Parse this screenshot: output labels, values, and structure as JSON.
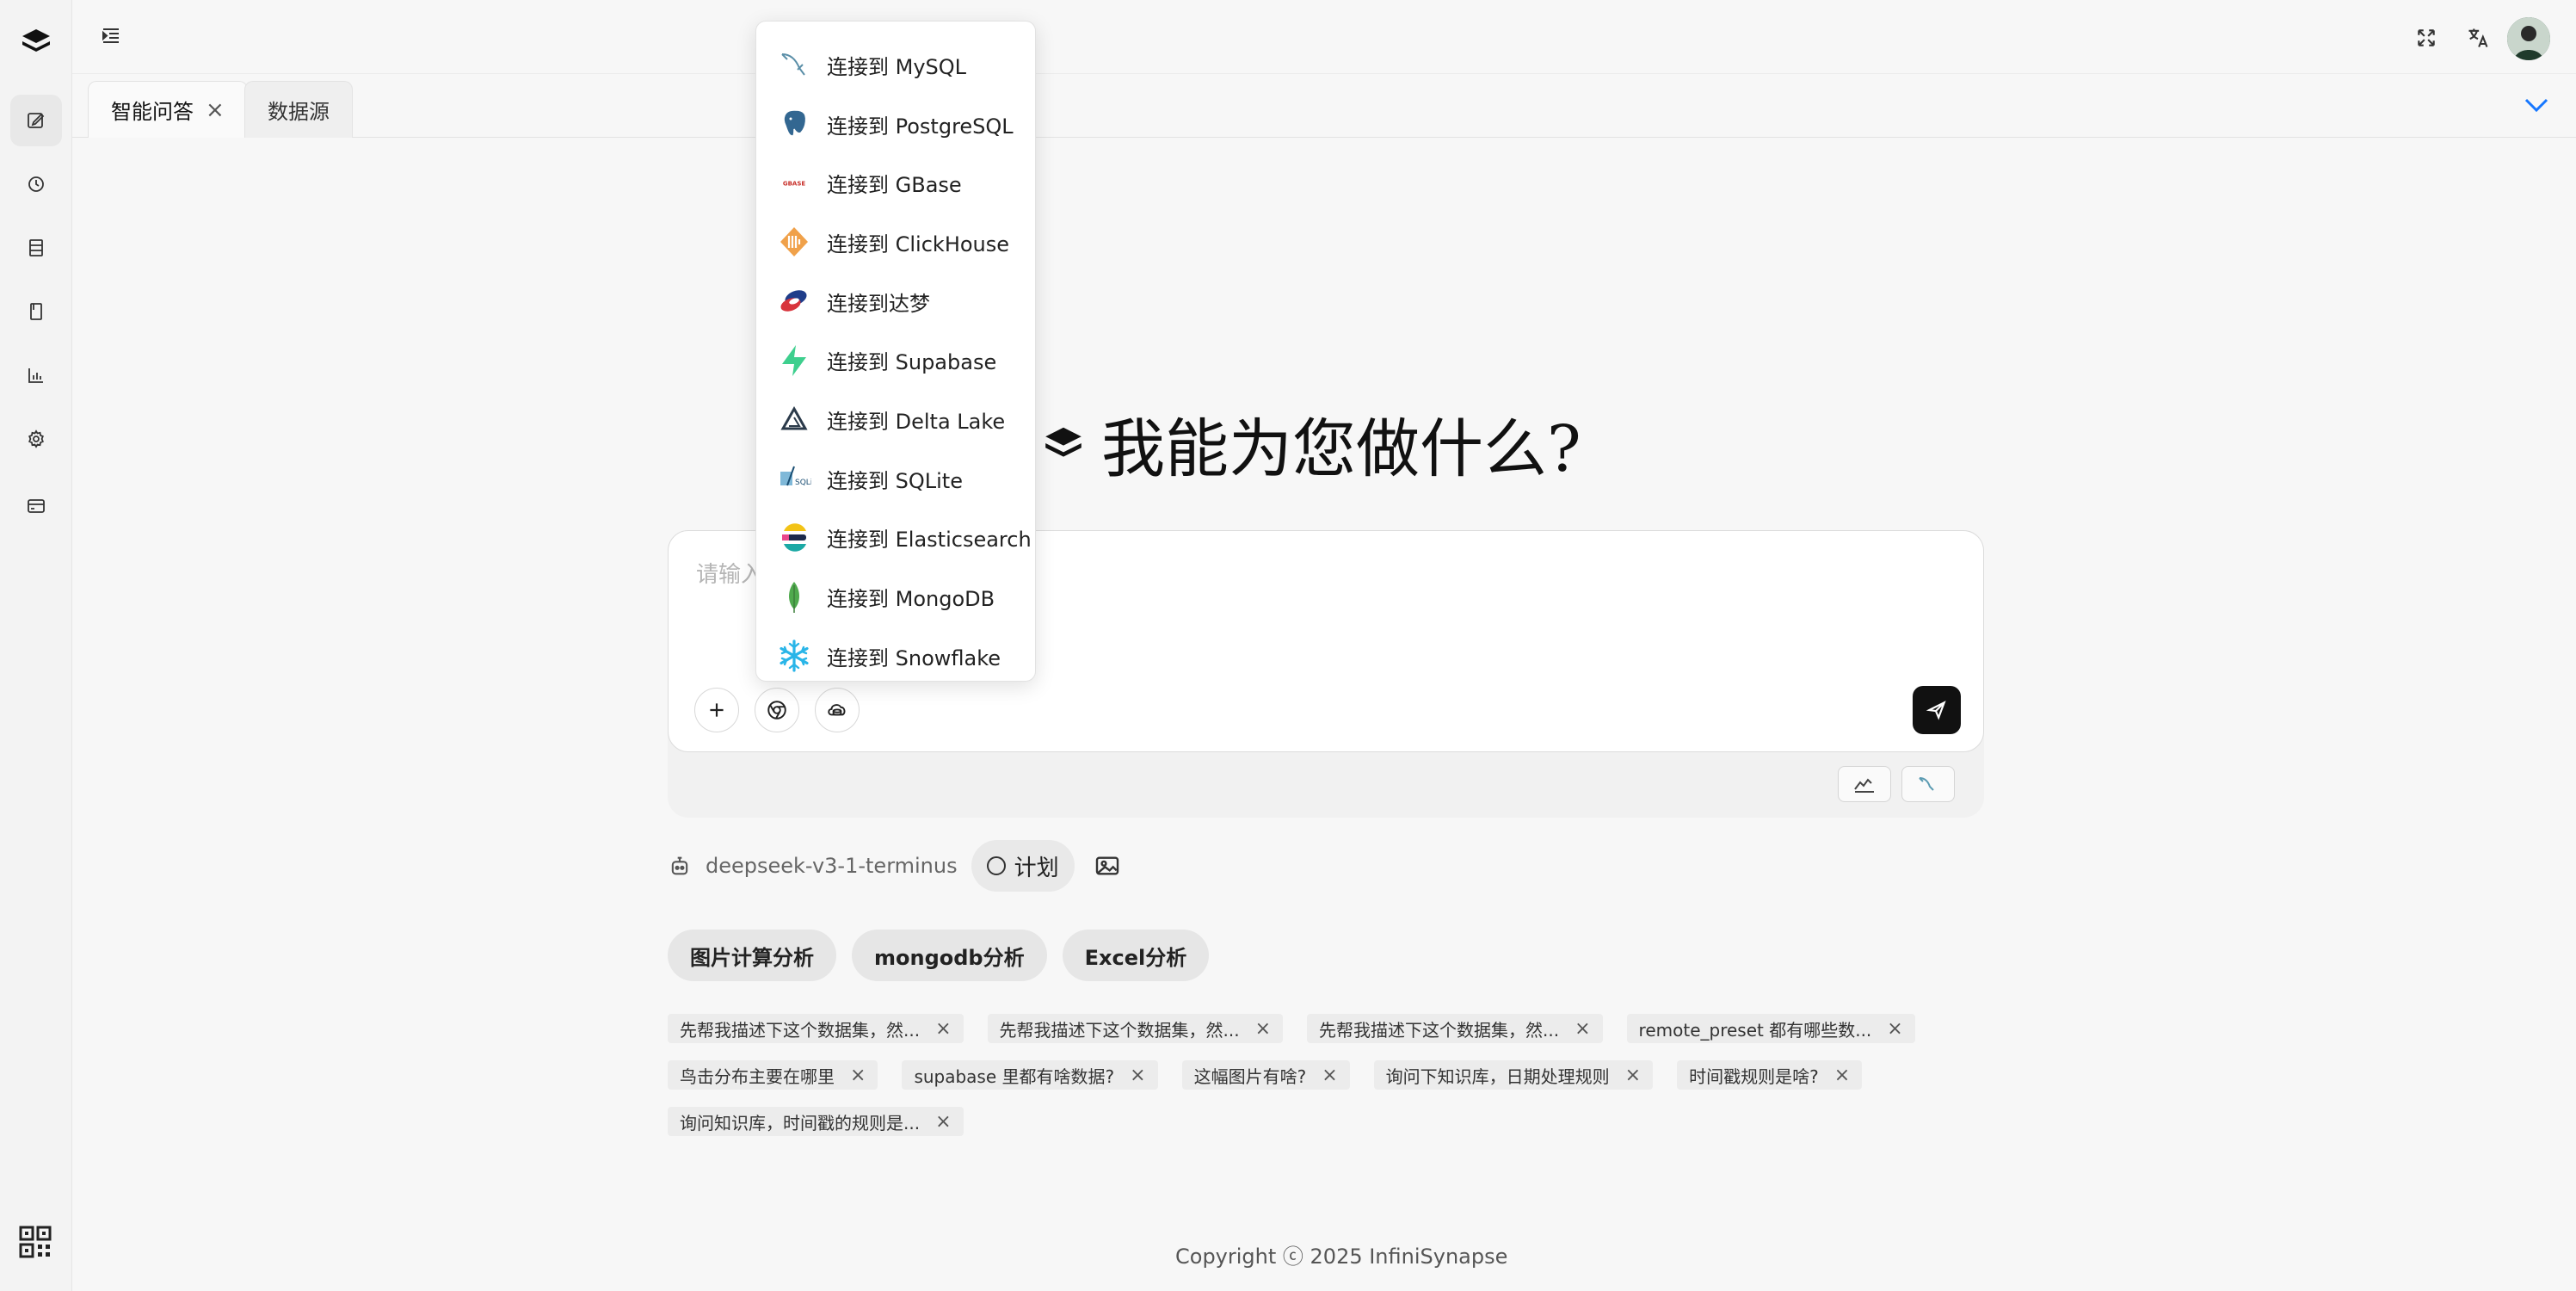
{
  "sidebar": {
    "items": [
      {
        "name": "new-chat",
        "icon": "edit-icon",
        "active": true
      },
      {
        "name": "history",
        "icon": "history-icon",
        "active": false
      },
      {
        "name": "database",
        "icon": "database-icon",
        "active": false
      },
      {
        "name": "knowledge",
        "icon": "book-icon",
        "active": false
      },
      {
        "name": "charts",
        "icon": "bar-chart-icon",
        "active": false
      },
      {
        "name": "settings",
        "icon": "gear-icon",
        "active": false
      },
      {
        "name": "billing",
        "icon": "card-icon",
        "active": false
      }
    ]
  },
  "tabs": [
    {
      "label": "智能问答",
      "active": true,
      "closable": true
    },
    {
      "label": "数据源",
      "active": false,
      "closable": false
    }
  ],
  "hero": {
    "title": "我能为您做什么?"
  },
  "input": {
    "placeholder": "请输入"
  },
  "model": {
    "name": "deepseek-v3-1-terminus"
  },
  "plan": {
    "label": "计划"
  },
  "quick_actions": [
    "图片计算分析",
    "mongodb分析",
    "Excel分析"
  ],
  "history": [
    [
      "先帮我描述下这个数据集，然...",
      "先帮我描述下这个数据集，然...",
      "先帮我描述下这个数据集，然...",
      "remote_preset 都有哪些数..."
    ],
    [
      "鸟击分布主要在哪里",
      "supabase 里都有啥数据?",
      "这幅图片有啥?",
      "询问下知识库，日期处理规则",
      "时间戳规则是啥?"
    ],
    [
      "询问知识库，时间戳的规则是..."
    ]
  ],
  "dropdown": {
    "items": [
      {
        "label": "连接到 MySQL",
        "icon": "mysql-icon"
      },
      {
        "label": "连接到 PostgreSQL",
        "icon": "postgresql-icon"
      },
      {
        "label": "连接到 GBase",
        "icon": "gbase-icon"
      },
      {
        "label": "连接到 ClickHouse",
        "icon": "clickhouse-icon"
      },
      {
        "label": "连接到达梦",
        "icon": "dameng-icon"
      },
      {
        "label": "连接到 Supabase",
        "icon": "supabase-icon"
      },
      {
        "label": "连接到 Delta Lake",
        "icon": "deltalake-icon"
      },
      {
        "label": "连接到 SQLite",
        "icon": "sqlite-icon"
      },
      {
        "label": "连接到 Elasticsearch",
        "icon": "elasticsearch-icon"
      },
      {
        "label": "连接到 MongoDB",
        "icon": "mongodb-icon"
      },
      {
        "label": "连接到 Snowflake",
        "icon": "snowflake-icon"
      }
    ]
  },
  "footer": {
    "copyright": "Copyright ⓒ 2025 InfiniSynapse"
  },
  "colors": {
    "accent": "#1677ff",
    "send": "#111111"
  }
}
